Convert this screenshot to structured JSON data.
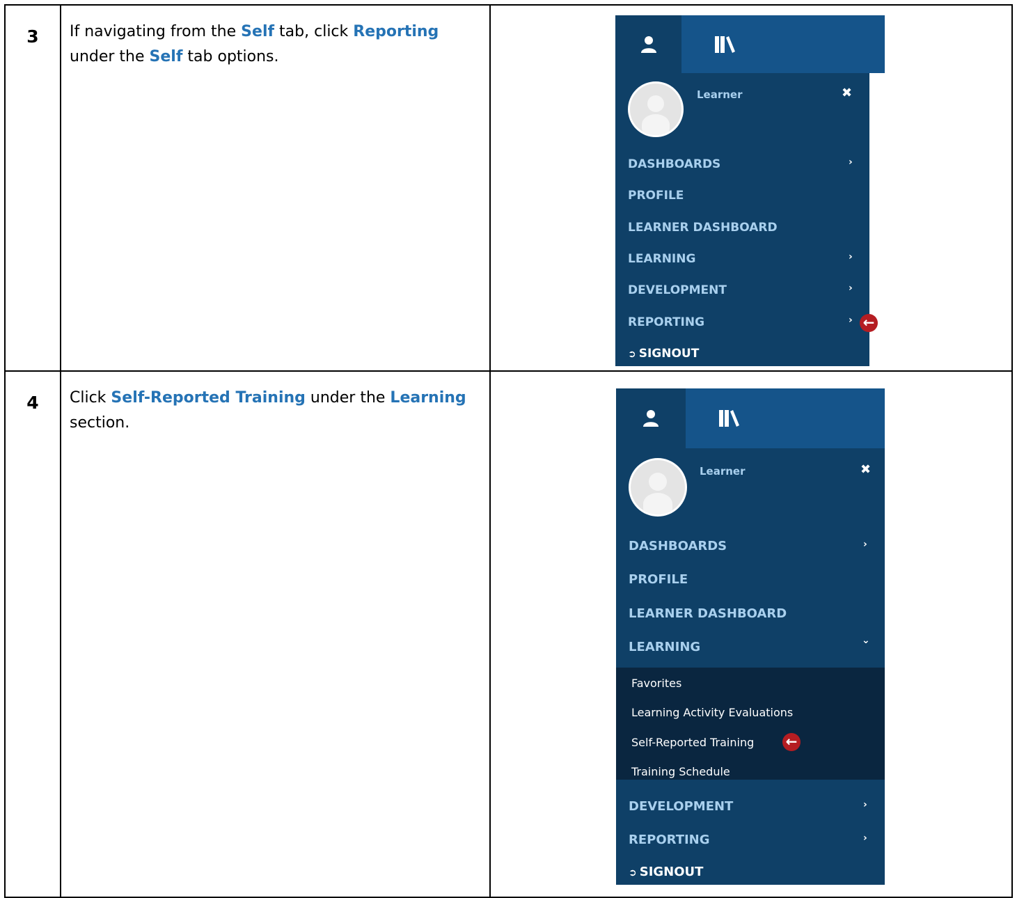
{
  "steps": [
    {
      "number": "3",
      "text": [
        {
          "t": "If navigating from the ",
          "hl": false
        },
        {
          "t": "Self",
          "hl": true
        },
        {
          "t": " tab, click ",
          "hl": false
        },
        {
          "t": "Reporting",
          "hl": true
        },
        {
          "t": " under the ",
          "hl": false
        },
        {
          "t": "Self",
          "hl": true
        },
        {
          "t": " tab options.",
          "hl": false
        }
      ]
    },
    {
      "number": "4",
      "text": [
        {
          "t": "Click ",
          "hl": false
        },
        {
          "t": "Self-Reported Training",
          "hl": true
        },
        {
          "t": " under the ",
          "hl": false
        },
        {
          "t": "Learning",
          "hl": true
        },
        {
          "t": " section.",
          "hl": false
        }
      ]
    }
  ],
  "colors": {
    "highlight": "#2573b5",
    "menu_bg": "#0f4067",
    "tab_bg": "#15548a",
    "submenu_bg": "#0a2640",
    "menu_text": "#a9d0ee",
    "arrow": "#b51d22"
  },
  "menu1": {
    "icons": {
      "self_tab": "user-icon",
      "library_tab": "books-icon",
      "close": "close-icon",
      "chevron": "chevron-right-icon",
      "pointer": "arrow-left-circle-icon",
      "signout": "sign-out-icon"
    },
    "username": "Learner",
    "close": "✖",
    "items": [
      "DASHBOARDS",
      "PROFILE",
      "LEARNER DASHBOARD",
      "LEARNING",
      "DEVELOPMENT",
      "REPORTING"
    ],
    "chevron": "›",
    "signout": "SIGNOUT",
    "arrow": "←"
  },
  "menu2": {
    "username": "Learner",
    "close": "✖",
    "items": [
      "DASHBOARDS",
      "PROFILE",
      "LEARNER DASHBOARD",
      "LEARNING"
    ],
    "learning_chevron": "⌄",
    "submenu": [
      "Favorites",
      "Learning Activity Evaluations",
      "Self-Reported Training",
      "Training Schedule"
    ],
    "items_after": [
      "DEVELOPMENT",
      "REPORTING"
    ],
    "chevron": "›",
    "signout": "SIGNOUT",
    "arrow": "←"
  }
}
